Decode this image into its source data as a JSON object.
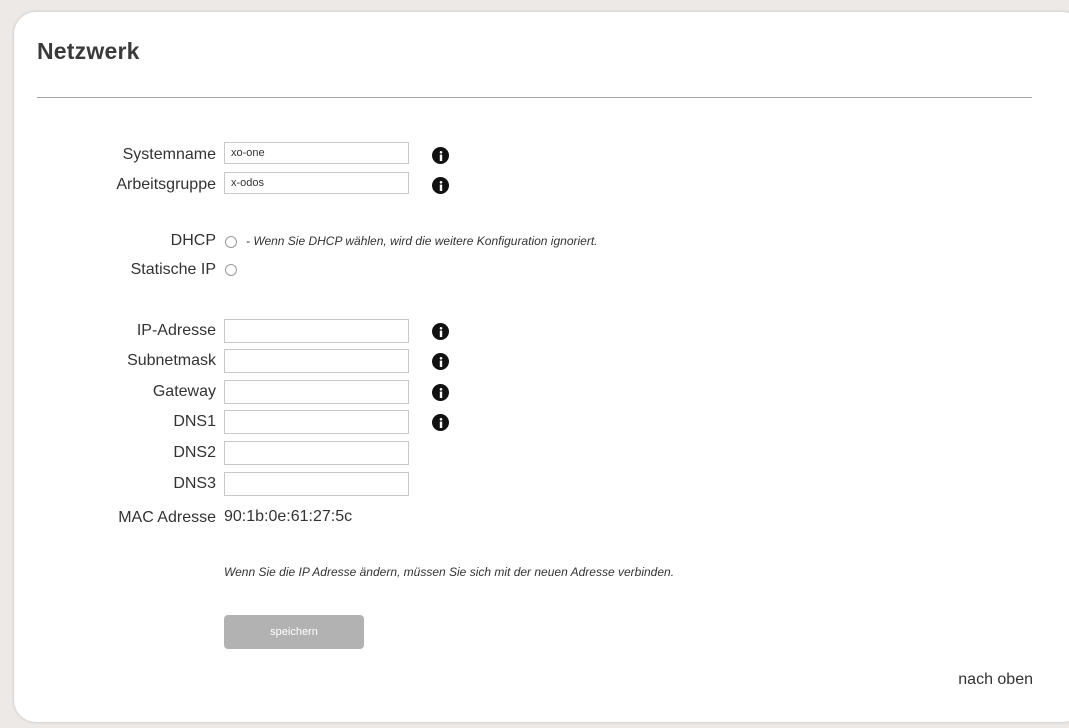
{
  "page": {
    "title": "Netzwerk"
  },
  "fields": {
    "systemname": {
      "label": "Systemname",
      "value": "xo-one"
    },
    "arbeitsgruppe": {
      "label": "Arbeitsgruppe",
      "value": "x-odos"
    },
    "ip": {
      "label": "IP-Adresse",
      "value": ""
    },
    "subnet": {
      "label": "Subnetmask",
      "value": ""
    },
    "gateway": {
      "label": "Gateway",
      "value": ""
    },
    "dns1": {
      "label": "DNS1",
      "value": ""
    },
    "dns2": {
      "label": "DNS2",
      "value": ""
    },
    "dns3": {
      "label": "DNS3",
      "value": ""
    }
  },
  "mode": {
    "dhcp_label": "DHCP",
    "dhcp_hint": "- Wenn Sie DHCP wählen, wird die weitere Konfiguration ignoriert.",
    "static_label": "Statische IP"
  },
  "mac": {
    "label": "MAC Adresse",
    "value": "90:1b:0e:61:27:5c"
  },
  "notice": "Wenn Sie die IP Adresse ändern, müssen Sie sich mit der neuen Adresse verbinden.",
  "save_label": "speichern",
  "back_to_top": "nach oben",
  "icons": {
    "info": "info-icon"
  },
  "colors": {
    "button": "#b2b2b2",
    "rule": "#a6a6a6",
    "background": "#ece9e7"
  }
}
